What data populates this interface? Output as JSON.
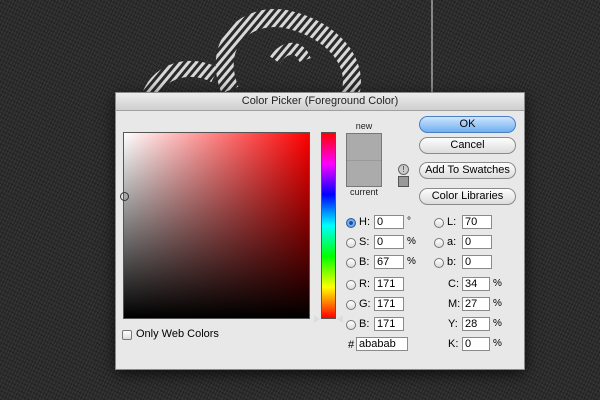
{
  "dialog": {
    "title": "Color Picker (Foreground Color)",
    "buttons": {
      "ok": "OK",
      "cancel": "Cancel",
      "add_to_swatches": "Add To Swatches",
      "color_libraries": "Color Libraries"
    },
    "swatch": {
      "new_label": "new",
      "current_label": "current",
      "new_color": "#ababab",
      "current_color": "#ababab"
    },
    "only_web_colors": {
      "label": "Only Web Colors",
      "checked": false
    },
    "hsb": {
      "h": {
        "label": "H:",
        "value": "0",
        "unit": "°",
        "selected": true
      },
      "s": {
        "label": "S:",
        "value": "0",
        "unit": "%"
      },
      "b": {
        "label": "B:",
        "value": "67",
        "unit": "%"
      }
    },
    "rgb": {
      "r": {
        "label": "R:",
        "value": "171"
      },
      "g": {
        "label": "G:",
        "value": "171"
      },
      "b": {
        "label": "B:",
        "value": "171"
      }
    },
    "lab": {
      "l": {
        "label": "L:",
        "value": "70"
      },
      "a": {
        "label": "a:",
        "value": "0"
      },
      "b": {
        "label": "b:",
        "value": "0"
      }
    },
    "cmyk": {
      "c": {
        "label": "C:",
        "value": "34",
        "unit": "%"
      },
      "m": {
        "label": "M:",
        "value": "27",
        "unit": "%"
      },
      "y": {
        "label": "Y:",
        "value": "28",
        "unit": "%"
      },
      "k": {
        "label": "K:",
        "value": "0",
        "unit": "%"
      }
    },
    "hex": {
      "label": "#",
      "value": "ababab"
    }
  },
  "colors": {
    "accent": "#6fb0f2",
    "field_hue": "#ff0000"
  }
}
